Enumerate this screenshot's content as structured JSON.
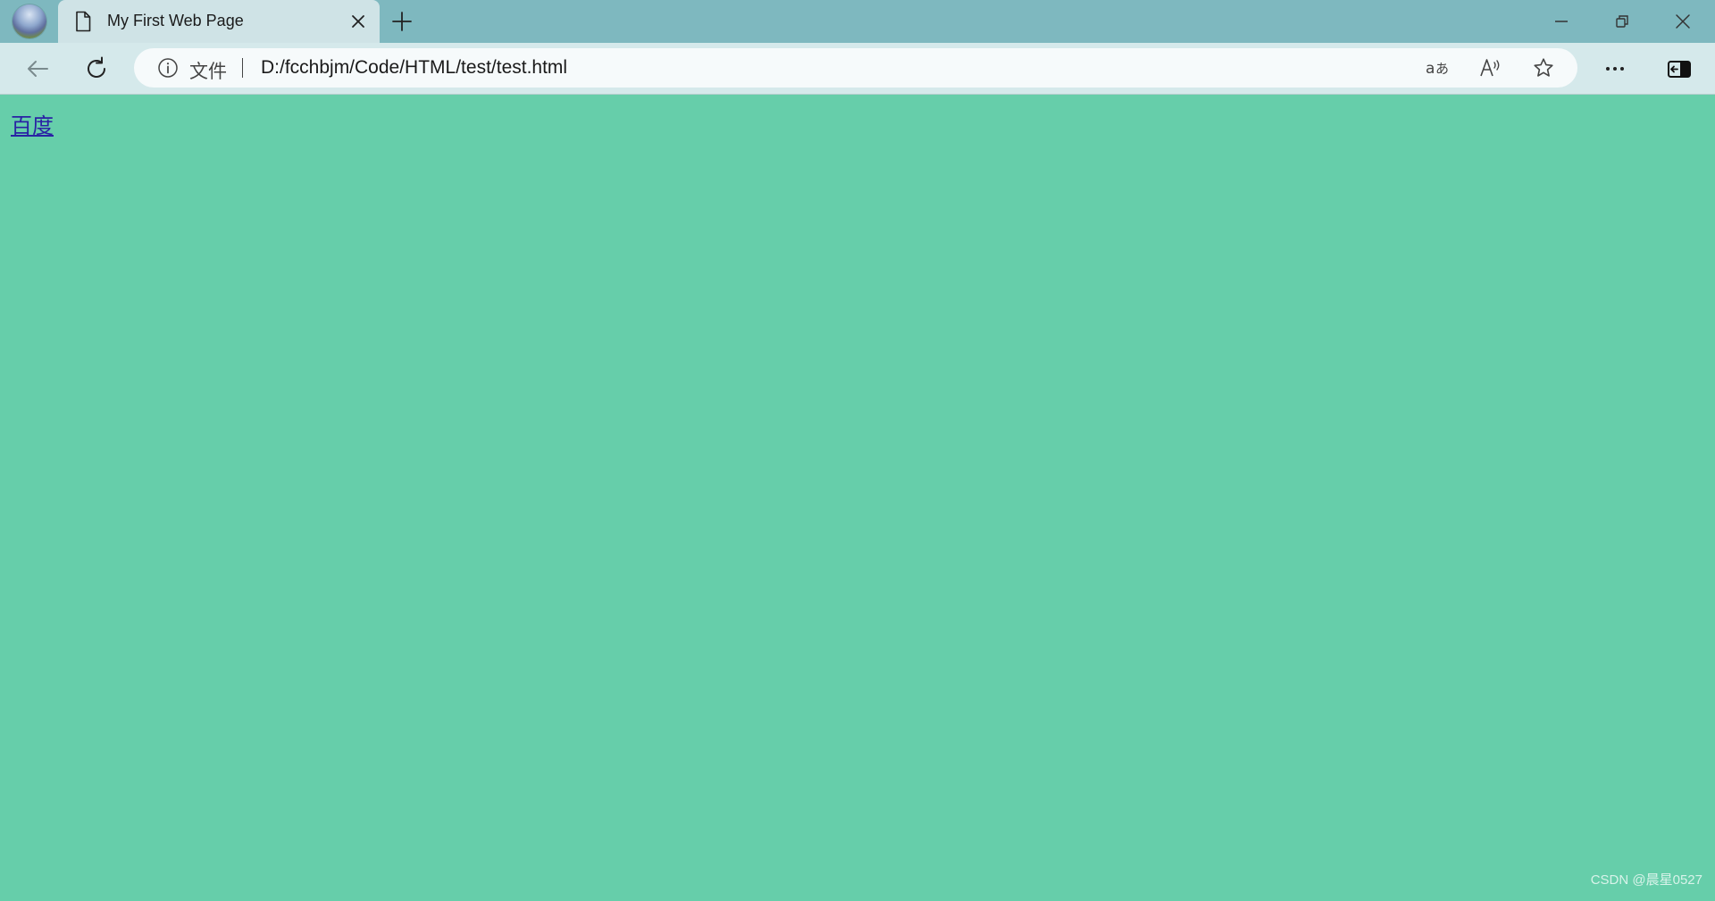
{
  "tab": {
    "title": "My First Web Page"
  },
  "addressbar": {
    "scheme_label": "文件",
    "url": "D:/fcchbjm/Code/HTML/test/test.html"
  },
  "page": {
    "background_color": "#66ceaa",
    "link_text": "百度",
    "link_color": "#2a22a4"
  },
  "watermark": "CSDN @晨星0527",
  "icons": {
    "profile": "profile-avatar",
    "tab": "page-icon",
    "close": "close-icon",
    "new_tab": "plus-icon",
    "back": "back-arrow-icon",
    "refresh": "refresh-icon",
    "info": "info-icon",
    "translate": "translate-icon",
    "read_aloud": "read-aloud-icon",
    "favorite": "star-icon",
    "more": "more-icon",
    "sidebar": "sidebar-icon"
  }
}
